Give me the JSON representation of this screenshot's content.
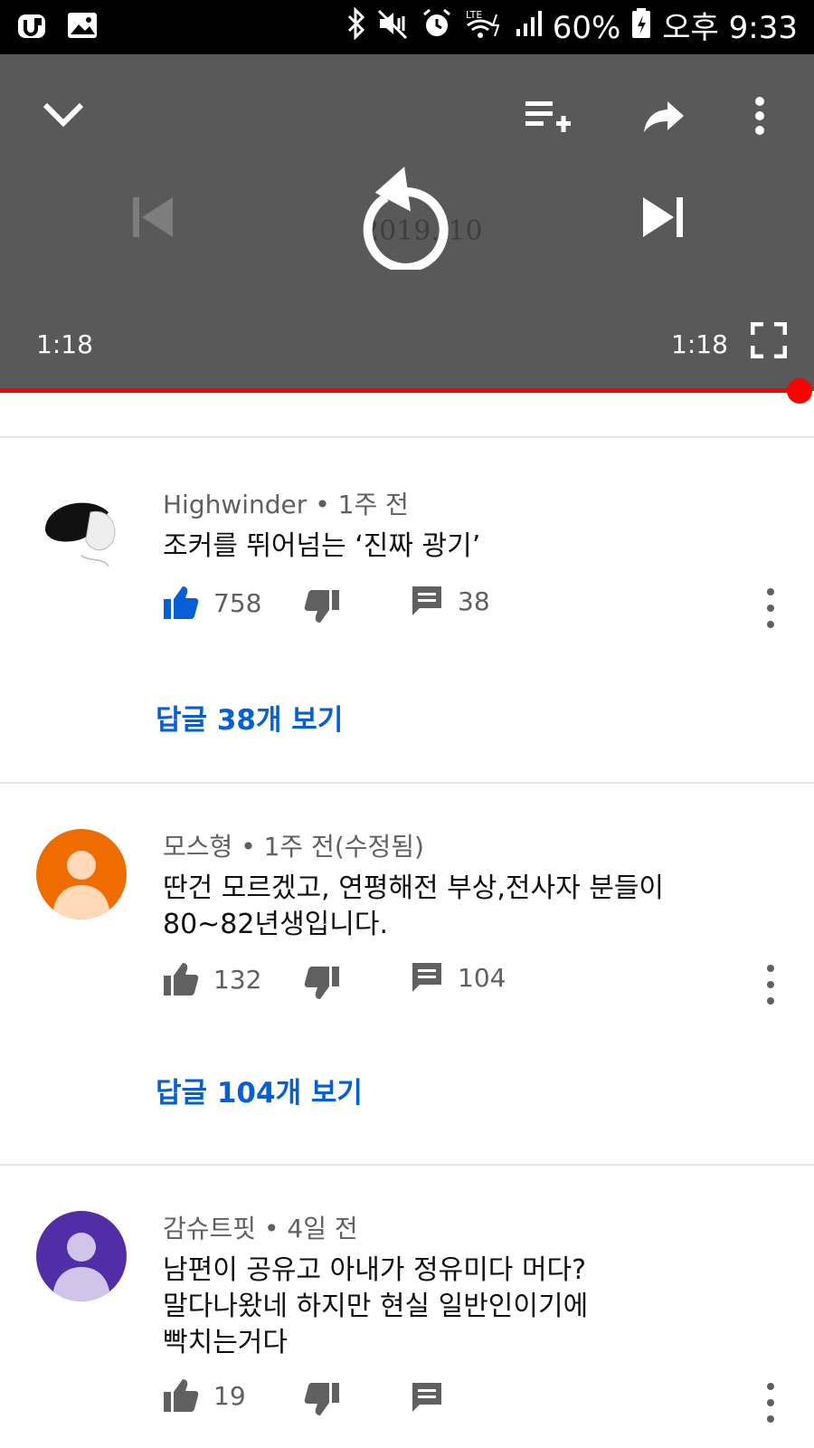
{
  "status_bar": {
    "battery": "60%",
    "time": "오후 9:33",
    "icons": [
      "app-icon",
      "gallery-icon",
      "bluetooth-icon",
      "mute-icon",
      "alarm-icon",
      "lte-wifi-icon",
      "signal-icon",
      "battery-icon"
    ]
  },
  "player": {
    "background_text": "2019. 10",
    "current_time": "1:18",
    "duration": "1:18",
    "progress": 1.0
  },
  "comments": [
    {
      "author": "Highwinder",
      "age": "1주 전",
      "text": "조커를 뛰어넘는 ‘진짜 광기’",
      "likes": "758",
      "reply_count": "38",
      "liked": true,
      "view_replies": {
        "prefix": "답글 ",
        "count": "38",
        "suffix": "개 보기"
      },
      "avatar_color": "#ffffff"
    },
    {
      "author": "모스형",
      "age": "1주 전(수정됨)",
      "text_lines": [
        "딴건 모르겠고, 연평해전 부상,전사자 분들이",
        "80~82년생입니다."
      ],
      "likes": "132",
      "reply_count": "104",
      "liked": false,
      "view_replies": {
        "prefix": "답글 ",
        "count": "104",
        "suffix": "개 보기"
      },
      "avatar_color": "#ef6c00"
    },
    {
      "author": "감슈트핏",
      "age": "4일 전",
      "text_lines": [
        "남편이 공유고 아내가 정유미다 머다?",
        "말다나왔네 하지만 현실 일반인이기에",
        "빡치는거다"
      ],
      "likes": "19",
      "liked": false,
      "avatar_color": "#512da8"
    }
  ],
  "colors": {
    "accent": "#065fd4",
    "progress": "#ff0000",
    "like_active": "#065fd4",
    "icon_gray": "#606060"
  }
}
